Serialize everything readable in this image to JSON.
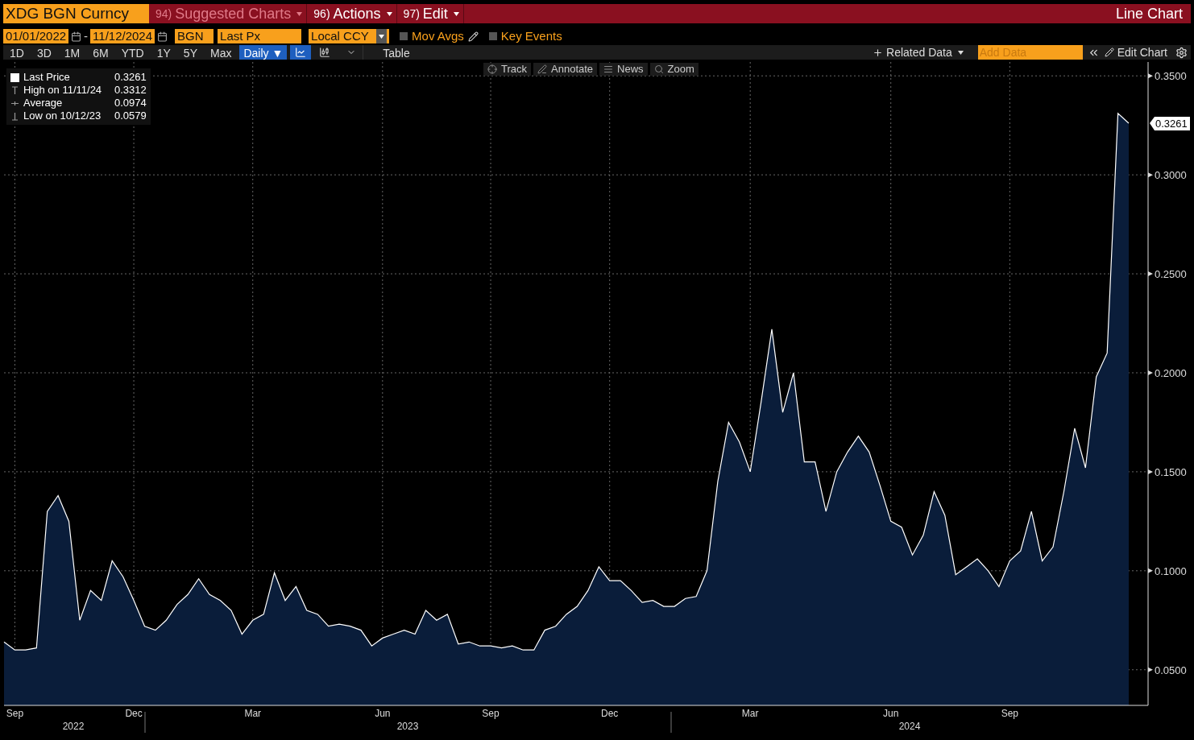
{
  "header": {
    "ticker": "XDG BGN Curncy",
    "menus": [
      {
        "number": "94)",
        "label": "Suggested Charts",
        "disabled": true
      },
      {
        "number": "96)",
        "label": "Actions",
        "disabled": false
      },
      {
        "number": "97)",
        "label": "Edit",
        "disabled": false
      }
    ],
    "title": "Line Chart"
  },
  "controls": {
    "start_date": "01/01/2022",
    "separator": "-",
    "end_date": "11/12/2024",
    "source": "BGN",
    "field": "Last Px",
    "currency": "Local CCY",
    "checkboxes": [
      {
        "label": "Mov Avgs",
        "checked": false,
        "kind": "edit"
      },
      {
        "label": "Key Events",
        "checked": false,
        "kind": "plain"
      }
    ]
  },
  "toolbar": {
    "periods": [
      {
        "label": "1D",
        "selected": false
      },
      {
        "label": "3D",
        "selected": false
      },
      {
        "label": "1M",
        "selected": false
      },
      {
        "label": "6M",
        "selected": false
      },
      {
        "label": "YTD",
        "selected": false
      },
      {
        "label": "1Y",
        "selected": false
      },
      {
        "label": "5Y",
        "selected": false
      },
      {
        "label": "Max",
        "selected": false
      }
    ],
    "frequency": {
      "label": "Daily",
      "caret": "▼"
    },
    "chart_types": [
      {
        "kind": "line",
        "selected": true
      },
      {
        "kind": "bar",
        "selected": false
      }
    ],
    "table": "Table",
    "related_data": "Related Data",
    "add_data": {
      "placeholder": "Add Data"
    },
    "edit_chart": "Edit Chart"
  },
  "chart_tools": [
    {
      "kind": "track",
      "label": "Track"
    },
    {
      "kind": "annotate",
      "label": "Annotate"
    },
    {
      "kind": "news",
      "label": "News"
    },
    {
      "kind": "zoom",
      "label": "Zoom"
    }
  ],
  "legend": [
    {
      "kind": "line",
      "label": "Last Price",
      "value": "0.3261"
    },
    {
      "kind": "high",
      "label": "High on 11/11/24",
      "value": "0.3312"
    },
    {
      "kind": "average",
      "label": "Average",
      "value": "0.0974"
    },
    {
      "kind": "low",
      "label": "Low on 10/12/23",
      "value": "0.0579"
    }
  ],
  "last_value_label": "0.3261",
  "years": [
    {
      "label": "2022"
    },
    {
      "label": "2023"
    },
    {
      "label": "2024"
    }
  ],
  "chart_data": {
    "type": "area",
    "grid": true,
    "ylim": [
      0.032,
      0.357
    ],
    "categories": [
      null,
      "Sep",
      null,
      null,
      null,
      null,
      null,
      null,
      null,
      null,
      null,
      null,
      "Dec",
      null,
      null,
      null,
      null,
      null,
      null,
      null,
      null,
      null,
      null,
      "Mar",
      null,
      null,
      null,
      null,
      null,
      null,
      null,
      null,
      null,
      null,
      null,
      "Jun",
      null,
      null,
      null,
      null,
      null,
      null,
      null,
      null,
      null,
      "Sep",
      null,
      null,
      null,
      null,
      null,
      null,
      null,
      null,
      null,
      null,
      "Dec",
      null,
      null,
      null,
      null,
      null,
      null,
      null,
      null,
      null,
      null,
      null,
      null,
      "Mar",
      null,
      null,
      null,
      null,
      null,
      null,
      null,
      null,
      null,
      null,
      null,
      null,
      "Jun",
      null,
      null,
      null,
      null,
      null,
      null,
      null,
      null,
      null,
      null,
      "Sep",
      null,
      null,
      null,
      null,
      null,
      null,
      null,
      null,
      null,
      null,
      null
    ],
    "yticks": [
      {
        "value": 0.05,
        "label": "0.0500"
      },
      {
        "value": 0.1,
        "label": "0.1000"
      },
      {
        "value": 0.15,
        "label": "0.1500"
      },
      {
        "value": 0.2,
        "label": "0.2000"
      },
      {
        "value": 0.25,
        "label": "0.2500"
      },
      {
        "value": 0.3,
        "label": "0.3000"
      },
      {
        "value": 0.35,
        "label": "0.3500"
      }
    ],
    "series": [
      {
        "color": "#ffffff",
        "values": [
          0.064,
          0.06,
          0.06,
          0.061,
          0.13,
          0.138,
          0.125,
          0.075,
          0.09,
          0.085,
          0.105,
          0.097,
          0.085,
          0.072,
          0.07,
          0.075,
          0.083,
          0.088,
          0.096,
          0.088,
          0.085,
          0.08,
          0.068,
          0.075,
          0.078,
          0.099,
          0.085,
          0.092,
          0.08,
          0.078,
          0.072,
          0.073,
          0.072,
          0.07,
          0.062,
          0.066,
          0.068,
          0.07,
          0.068,
          0.08,
          0.075,
          0.078,
          0.063,
          0.064,
          0.062,
          0.062,
          0.061,
          0.062,
          0.06,
          0.06,
          0.07,
          0.072,
          0.078,
          0.082,
          0.09,
          0.102,
          0.095,
          0.095,
          0.09,
          0.084,
          0.085,
          0.082,
          0.082,
          0.086,
          0.087,
          0.1,
          0.145,
          0.175,
          0.165,
          0.15,
          0.185,
          0.222,
          0.18,
          0.2,
          0.155,
          0.155,
          0.13,
          0.15,
          0.16,
          0.168,
          0.16,
          0.143,
          0.125,
          0.122,
          0.108,
          0.118,
          0.14,
          0.128,
          0.098,
          0.102,
          0.106,
          0.1,
          0.092,
          0.105,
          0.11,
          0.13,
          0.105,
          0.112,
          0.14,
          0.172,
          0.152,
          0.198,
          0.21,
          0.331,
          0.3261
        ]
      }
    ]
  }
}
